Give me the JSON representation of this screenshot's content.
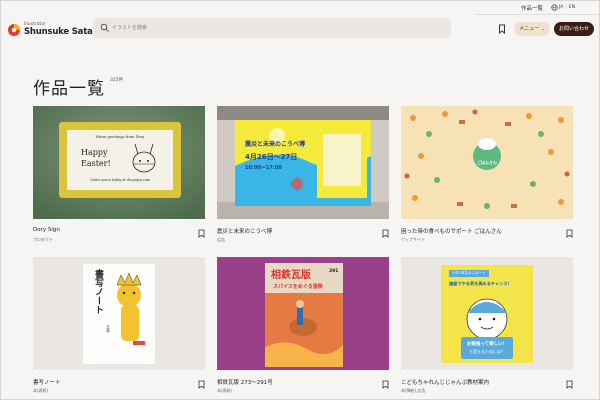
{
  "header": {
    "logo_small": "illustrator",
    "logo_name": "Shunsuke Satake",
    "search_placeholder": "イラストを検索",
    "works_link": "作品一覧",
    "lang_ja": "JA",
    "lang_en": "EN",
    "menu_label": "メニュー",
    "contact_label": "お問い合わせ"
  },
  "page": {
    "title": "作品一覧",
    "count": "325件"
  },
  "colors": {
    "background": "#f7f5f3",
    "accent_dark": "#3a1e16",
    "menu_bg": "#f0e2cf",
    "logo_red": "#e8392a",
    "logo_yellow": "#f4b400"
  },
  "cards": [
    {
      "title": "Dory Sign",
      "category": "プロダクト",
      "thumb": {
        "header": "Warm greetings from Dory",
        "line1": "Happy",
        "line2": "Easter!",
        "footer": "Order yours today at dorysign.com"
      }
    },
    {
      "title": "震災と未来のこうべ博",
      "category": "広告",
      "thumb": {
        "heading": "震災と未来のこうべ博",
        "date": "4月26日～27日",
        "time": "10:00～17:00"
      }
    },
    {
      "title": "困った時の食べものサポート ごはんさん",
      "category": "ウェブサイト",
      "thumb": {
        "badge": "ごはんさん"
      }
    },
    {
      "title": "書写ノート",
      "category": "本(表紙)",
      "thumb": {
        "vertical_title": "書写ノート",
        "grade": "五年"
      }
    },
    {
      "title": "相鉄瓦版 273～291号",
      "category": "本(表紙)",
      "thumb": {
        "heading": "相鉄瓦版",
        "issue": "291",
        "sub": "スパイスをめぐる冒険"
      }
    },
    {
      "title": "こどもちゃれんじじゃんぷ教材案内",
      "category": "本(挿絵),広告",
      "thumb": {
        "ribbon": "小学1年生のスタート",
        "heading": "進級でやる気を高めるチャンス！",
        "bubble1": "お勉強って楽しい！",
        "bubble2": "と思えるためには？"
      }
    }
  ]
}
